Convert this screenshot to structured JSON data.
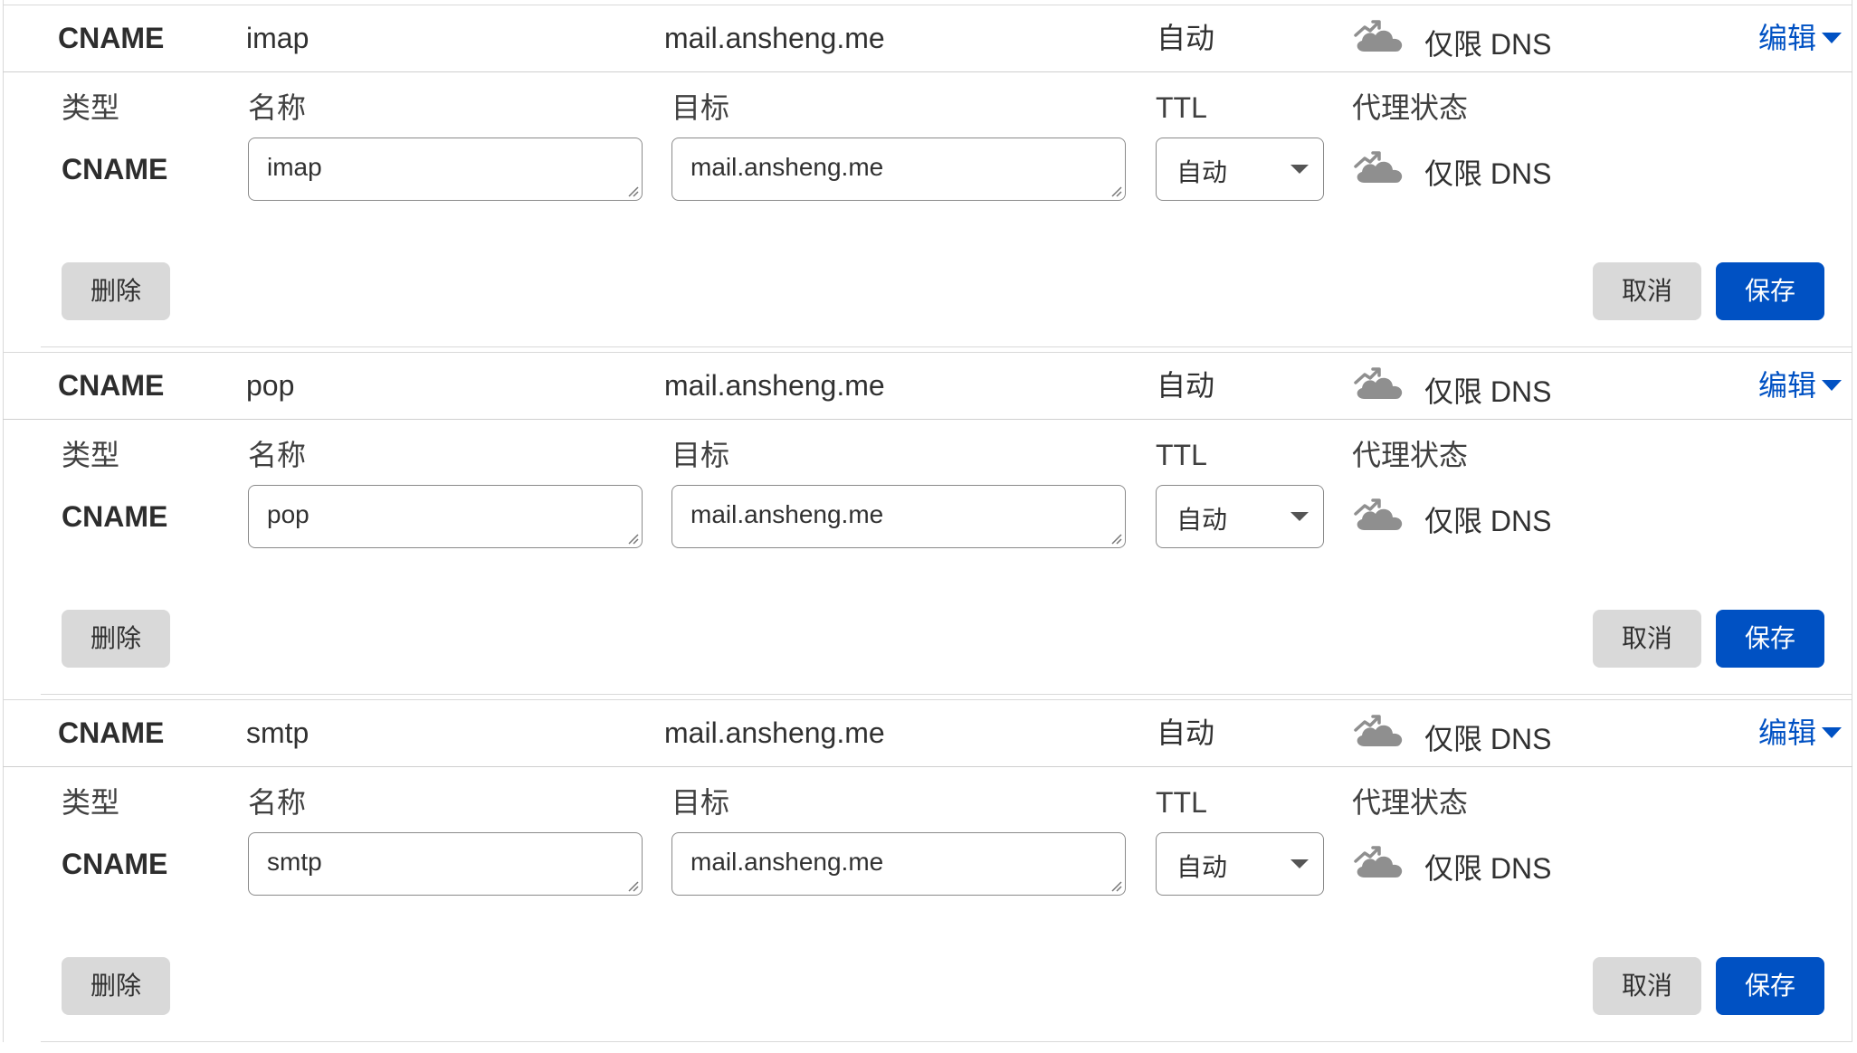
{
  "form_labels": {
    "type": "类型",
    "name": "名称",
    "target": "目标",
    "ttl": "TTL",
    "proxy_status": "代理状态"
  },
  "actions": {
    "edit": "编辑",
    "delete": "删除",
    "cancel": "取消",
    "save": "保存"
  },
  "icons": {
    "proxy": "dns-only-cloud-icon",
    "edit_caret": "caret-down-icon",
    "select_caret": "dropdown-arrow-icon"
  },
  "colors": {
    "accent": "#0051c3",
    "button_gray": "#d9d9d9",
    "cloud_gray": "#8f8f8f"
  },
  "records": [
    {
      "type": "CNAME",
      "name": "imap",
      "target": "mail.ansheng.me",
      "ttl": "自动",
      "proxy_status": "仅限 DNS"
    },
    {
      "type": "CNAME",
      "name": "pop",
      "target": "mail.ansheng.me",
      "ttl": "自动",
      "proxy_status": "仅限 DNS"
    },
    {
      "type": "CNAME",
      "name": "smtp",
      "target": "mail.ansheng.me",
      "ttl": "自动",
      "proxy_status": "仅限 DNS"
    }
  ]
}
